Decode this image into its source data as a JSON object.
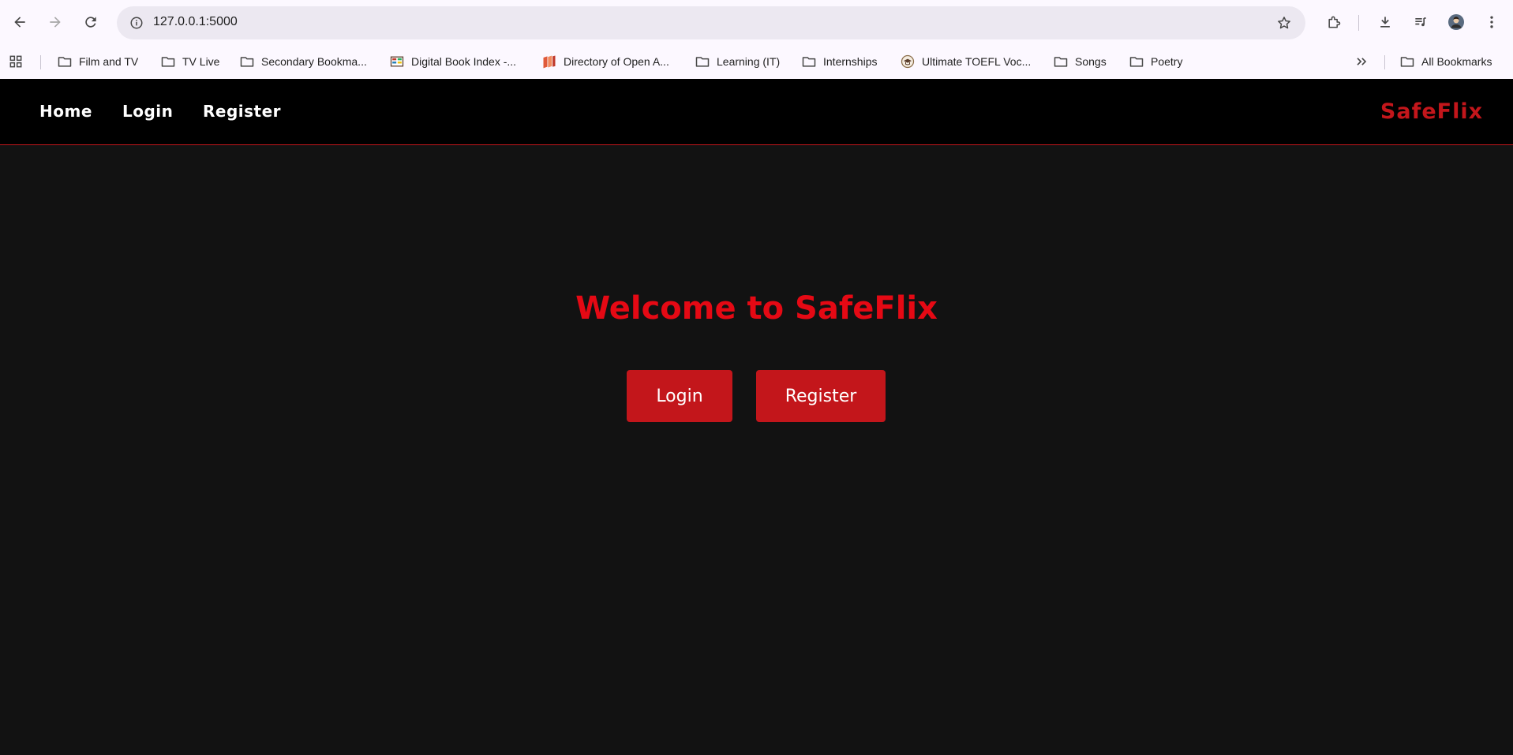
{
  "browser": {
    "url": "127.0.0.1:5000",
    "bookmarks": [
      {
        "label": "Film and TV",
        "icon": "folder-icon"
      },
      {
        "label": "TV Live",
        "icon": "folder-icon"
      },
      {
        "label": "Secondary Bookma...",
        "icon": "folder-icon"
      },
      {
        "label": "Digital Book Index -...",
        "icon": "book-favicon"
      },
      {
        "label": "Directory of Open A...",
        "icon": "doaj-favicon"
      },
      {
        "label": "Learning (IT)",
        "icon": "folder-icon"
      },
      {
        "label": "Internships",
        "icon": "folder-icon"
      },
      {
        "label": "Ultimate TOEFL Voc...",
        "icon": "toefl-favicon"
      },
      {
        "label": "Songs",
        "icon": "folder-icon"
      },
      {
        "label": "Poetry",
        "icon": "folder-icon"
      }
    ],
    "all_bookmarks": "All Bookmarks"
  },
  "navbar": {
    "links": [
      "Home",
      "Login",
      "Register"
    ],
    "brand": "SafeFlix"
  },
  "hero": {
    "title": "Welcome to SafeFlix",
    "login_button": "Login",
    "register_button": "Register"
  },
  "colors": {
    "brand_red": "#e50914",
    "button_red": "#c3161b",
    "page_bg": "#121212",
    "nav_bg": "#000000"
  }
}
